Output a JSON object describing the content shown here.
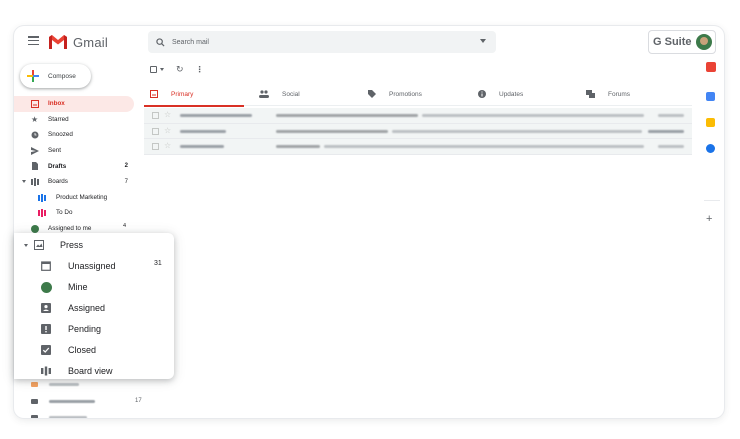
{
  "header": {
    "app_name": "Gmail",
    "search_placeholder": "Search mail",
    "gsuite_label": "G Suite"
  },
  "compose_label": "Compose",
  "nav": [
    {
      "label": "Inbox",
      "count": "",
      "icon": "inbox-icon"
    },
    {
      "label": "Starred",
      "count": "",
      "icon": "star-icon"
    },
    {
      "label": "Snoozed",
      "count": "",
      "icon": "clock-icon"
    },
    {
      "label": "Sent",
      "count": "",
      "icon": "send-icon"
    },
    {
      "label": "Drafts",
      "count": "2",
      "icon": "draft-icon"
    },
    {
      "label": "Boards",
      "count": "7",
      "icon": "board-icon"
    },
    {
      "label": "Product Marketing",
      "count": "",
      "icon": "board-icon"
    },
    {
      "label": "To Do",
      "count": "",
      "icon": "board-icon"
    },
    {
      "label": "Assigned to me",
      "count": "4",
      "icon": "avatar-icon"
    }
  ],
  "press": {
    "title": "Press",
    "items": [
      {
        "label": "Unassigned",
        "count": "31",
        "icon": "unassigned-icon"
      },
      {
        "label": "Mine",
        "count": "",
        "icon": "avatar-icon"
      },
      {
        "label": "Assigned",
        "count": "",
        "icon": "assigned-icon"
      },
      {
        "label": "Pending",
        "count": "",
        "icon": "pending-icon"
      },
      {
        "label": "Closed",
        "count": "",
        "icon": "closed-icon"
      },
      {
        "label": "Board view",
        "count": "",
        "icon": "board-icon"
      }
    ]
  },
  "sidebar_bottom_count": "17",
  "tabs": [
    {
      "label": "Primary",
      "icon": "inbox-icon"
    },
    {
      "label": "Social",
      "icon": "people-icon"
    },
    {
      "label": "Promotions",
      "icon": "tag-icon"
    },
    {
      "label": "Updates",
      "icon": "info-icon"
    },
    {
      "label": "Forums",
      "icon": "forum-icon"
    }
  ],
  "colors": {
    "gmail_red": "#d93025",
    "active_bg": "#fce8e6",
    "board_blue": "#1a73e8",
    "board_pink": "#e91e63"
  }
}
